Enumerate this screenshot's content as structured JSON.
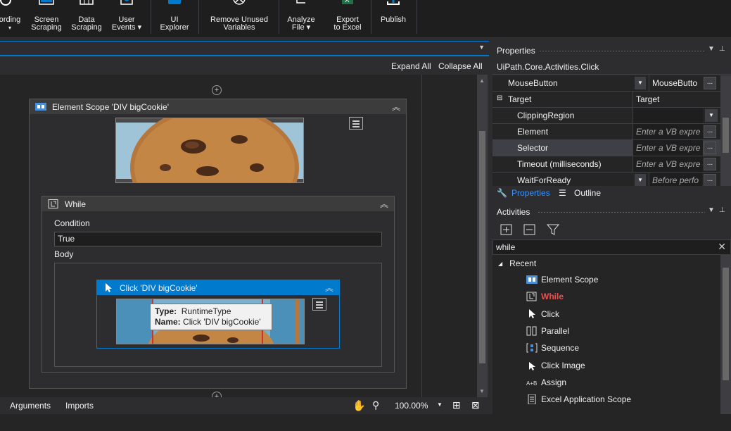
{
  "ribbon": {
    "buttons": [
      {
        "label1": "ording",
        "label2": "▾"
      },
      {
        "label1": "Screen",
        "label2": "Scraping"
      },
      {
        "label1": "Data",
        "label2": "Scraping"
      },
      {
        "label1": "User",
        "label2": "Events ▾"
      },
      {
        "label1": "UI",
        "label2": "Explorer"
      },
      {
        "label1": "Remove Unused",
        "label2": "Variables"
      },
      {
        "label1": "Analyze",
        "label2": "File ▾"
      },
      {
        "label1": "Export",
        "label2": "to Excel"
      },
      {
        "label1": "Publish",
        "label2": ""
      }
    ]
  },
  "designer": {
    "expand_all": "Expand All",
    "collapse_all": "Collapse All",
    "element_scope": {
      "title": "Element Scope 'DIV  bigCookie'"
    },
    "while": {
      "title": "While",
      "condition_label": "Condition",
      "condition_value": "True",
      "body_label": "Body"
    },
    "click": {
      "title": "Click 'DIV  bigCookie'"
    },
    "tooltip": {
      "type_label": "Type:",
      "type_value": "RuntimeType",
      "name_label": "Name:",
      "name_value": "Click 'DIV  bigCookie'"
    }
  },
  "bottom": {
    "arguments": "Arguments",
    "imports": "Imports",
    "zoom": "100.00%"
  },
  "properties": {
    "title": "Properties",
    "type_name": "UiPath.Core.Activities.Click",
    "rows": [
      {
        "name": "MouseButton",
        "value": "MouseButto",
        "placeholder": false
      },
      {
        "name": "Target",
        "value": "Target",
        "placeholder": false
      },
      {
        "name": "ClippingRegion",
        "value": "",
        "placeholder": false
      },
      {
        "name": "Element",
        "value": "Enter a VB expre",
        "placeholder": true
      },
      {
        "name": "Selector",
        "value": "Enter a VB expre",
        "placeholder": true
      },
      {
        "name": "Timeout (milliseconds)",
        "value": "Enter a VB expre",
        "placeholder": true
      },
      {
        "name": "WaitForReady",
        "value": "Before perfo",
        "placeholder": true
      }
    ],
    "tab_properties": "Properties",
    "tab_outline": "Outline"
  },
  "activities": {
    "title": "Activities",
    "search_value": "while",
    "group": "Recent",
    "items": [
      {
        "label": "Element Scope",
        "highlight": false
      },
      {
        "label": "While",
        "highlight": true
      },
      {
        "label": "Click",
        "highlight": false
      },
      {
        "label": "Parallel",
        "highlight": false
      },
      {
        "label": "Sequence",
        "highlight": false
      },
      {
        "label": "Click Image",
        "highlight": false
      },
      {
        "label": "Assign",
        "highlight": false
      },
      {
        "label": "Excel Application Scope",
        "highlight": false
      }
    ]
  },
  "colors": {
    "accent": "#007acc",
    "highlight_text": "#f14c4c"
  }
}
